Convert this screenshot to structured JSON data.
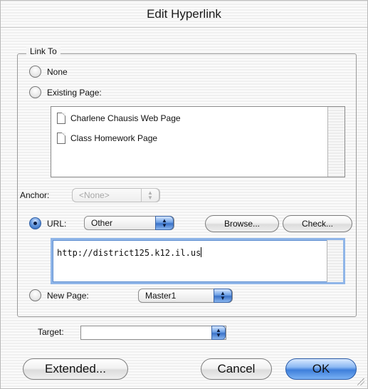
{
  "dialog": {
    "title": "Edit Hyperlink"
  },
  "link_to": {
    "legend": "Link To",
    "none_label": "None",
    "existing_page_label": "Existing Page:",
    "pages": [
      "Charlene Chausis Web Page",
      "Class Homework Page"
    ],
    "anchor_label": "Anchor:",
    "anchor_value": "<None>",
    "url_label": "URL:",
    "url_type": "Other",
    "browse_label": "Browse...",
    "check_label": "Check...",
    "url_value": "http://district125.k12.il.us",
    "new_page_label": "New Page:",
    "template_value": "Master1",
    "selected": "url"
  },
  "target": {
    "label": "Target:",
    "value": ""
  },
  "buttons": {
    "extended": "Extended...",
    "cancel": "Cancel",
    "ok": "OK"
  },
  "icons": {
    "page": "document-icon",
    "popup": "up-down-arrows-icon",
    "resize": "resize-grip-icon"
  },
  "colors": {
    "accent": "#3a72c8",
    "focus": "#8fb5e8"
  }
}
